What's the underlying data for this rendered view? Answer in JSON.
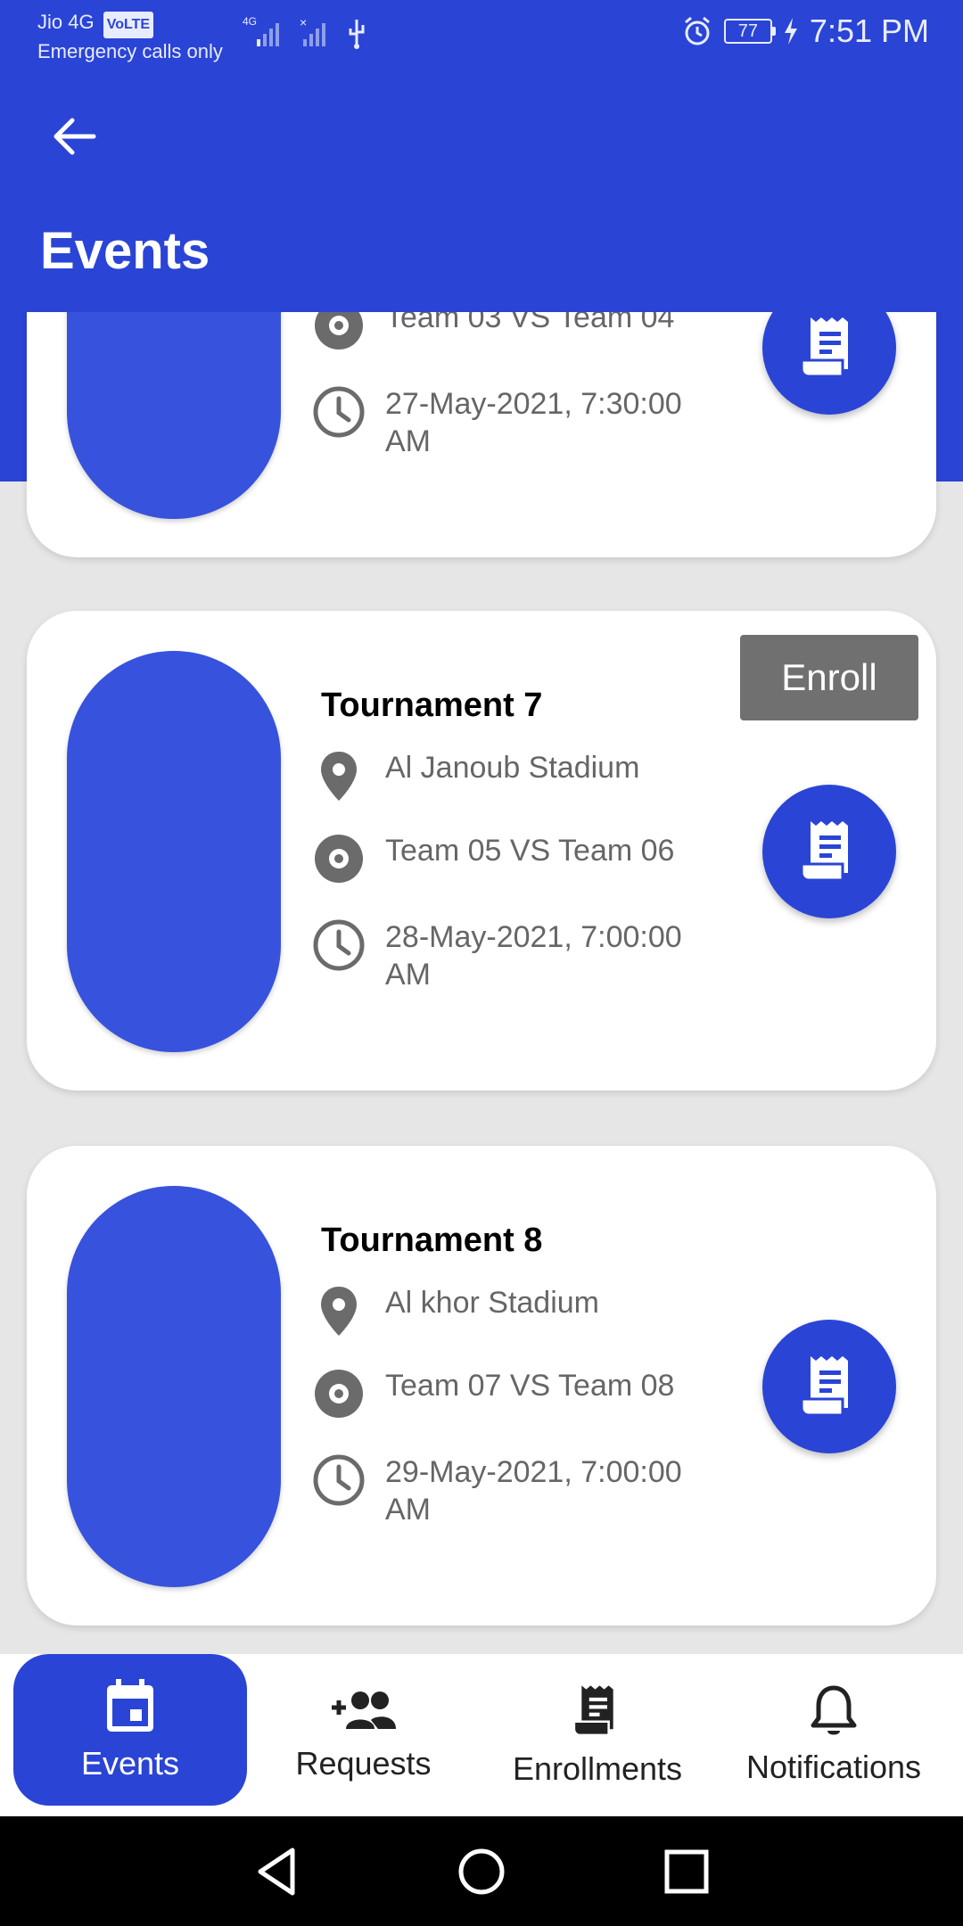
{
  "colors": {
    "primary": "#2a44d6",
    "card_image": "#3752dc",
    "enroll_button": "#707070",
    "muted_text": "#666666"
  },
  "status_bar": {
    "carrier": "Jio 4G",
    "volte": "VoLTE",
    "emergency": "Emergency calls only",
    "battery": "77",
    "time": "7:51 PM"
  },
  "app_bar": {
    "title": "Events",
    "back_icon": "arrow-left-icon"
  },
  "events": [
    {
      "title": "",
      "location": "",
      "teams": "Team 03 VS Team 04",
      "datetime": "27-May-2021, 7:30:00 AM",
      "enroll_label": ""
    },
    {
      "title": "Tournament 7",
      "location": "Al Janoub Stadium",
      "teams": "Team 05 VS Team 06",
      "datetime": "28-May-2021, 7:00:00 AM",
      "enroll_label": "Enroll"
    },
    {
      "title": "Tournament 8",
      "location": "Al khor Stadium",
      "teams": "Team 07 VS Team 08",
      "datetime": "29-May-2021, 7:00:00 AM",
      "enroll_label": ""
    }
  ],
  "bottom_nav": [
    {
      "label": "Events",
      "icon": "calendar-icon",
      "active": true
    },
    {
      "label": "Requests",
      "icon": "add-group-icon",
      "active": false
    },
    {
      "label": "Enrollments",
      "icon": "receipt-icon",
      "active": false
    },
    {
      "label": "Notifications",
      "icon": "bell-icon",
      "active": false
    }
  ],
  "system_nav": [
    "back-triangle-icon",
    "home-circle-icon",
    "recents-square-icon"
  ]
}
